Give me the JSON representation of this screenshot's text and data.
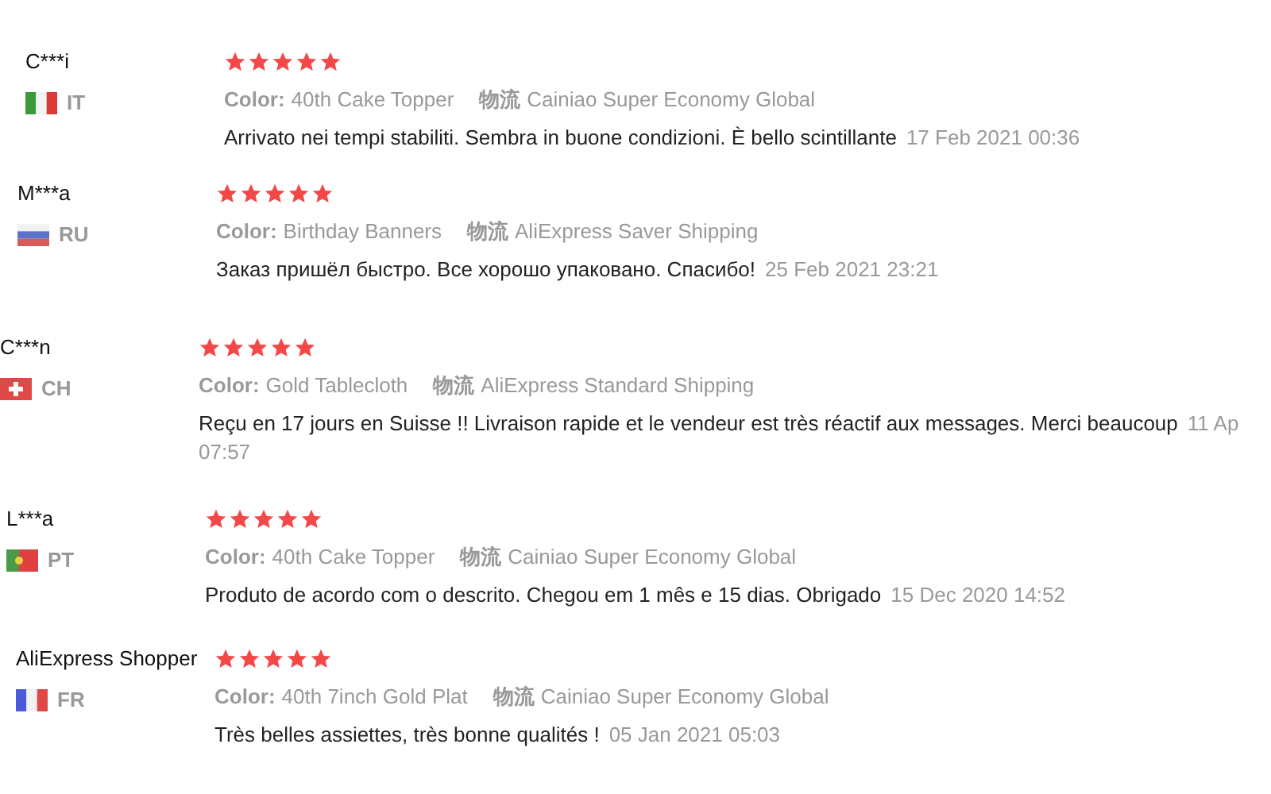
{
  "reviews": [
    {
      "name": "C***i",
      "country": "IT",
      "stars": 5,
      "attributes": [
        {
          "label": "Color:",
          "value": "40th Cake Topper"
        },
        {
          "label": "物流",
          "value": "Cainiao Super Economy Global"
        }
      ],
      "comment": "Arrivato nei tempi stabiliti. Sembra in buone condizioni. È bello scintillante",
      "date": [
        "17 Feb 2021 00:36"
      ]
    },
    {
      "name": "M***a",
      "country": "RU",
      "stars": 5,
      "attributes": [
        {
          "label": "Color:",
          "value": "Birthday Banners"
        },
        {
          "label": "物流",
          "value": "AliExpress Saver Shipping"
        }
      ],
      "comment": "Заказ пришёл быстро. Все хорошо упаковано. Спасибо!",
      "date": [
        "25 Feb 2021 23:21"
      ]
    },
    {
      "name": "C***n",
      "country": "CH",
      "stars": 5,
      "attributes": [
        {
          "label": "Color:",
          "value": "Gold Tablecloth"
        },
        {
          "label": "物流",
          "value": "AliExpress Standard Shipping"
        }
      ],
      "comment": "Reçu en 17 jours en Suisse !! Livraison rapide et le vendeur est très réactif aux messages. Merci beaucoup",
      "date": [
        "11 Ap",
        "07:57"
      ]
    },
    {
      "name": "L***a",
      "country": "PT",
      "stars": 5,
      "attributes": [
        {
          "label": "Color:",
          "value": "40th Cake Topper"
        },
        {
          "label": "物流",
          "value": "Cainiao Super Economy Global"
        }
      ],
      "comment": "Produto de acordo com o descrito. Chegou em 1 mês e 15 dias. Obrigado",
      "date": [
        "15 Dec 2020 14:52"
      ]
    },
    {
      "name": "AliExpress Shopper",
      "country": "FR",
      "stars": 5,
      "attributes": [
        {
          "label": "Color:",
          "value": "40th 7inch Gold Plat"
        },
        {
          "label": "物流",
          "value": "Cainiao Super Economy Global"
        }
      ],
      "comment": "Très belles assiettes, très bonne qualités !",
      "date": [
        "05 Jan 2021 05:03"
      ]
    }
  ]
}
